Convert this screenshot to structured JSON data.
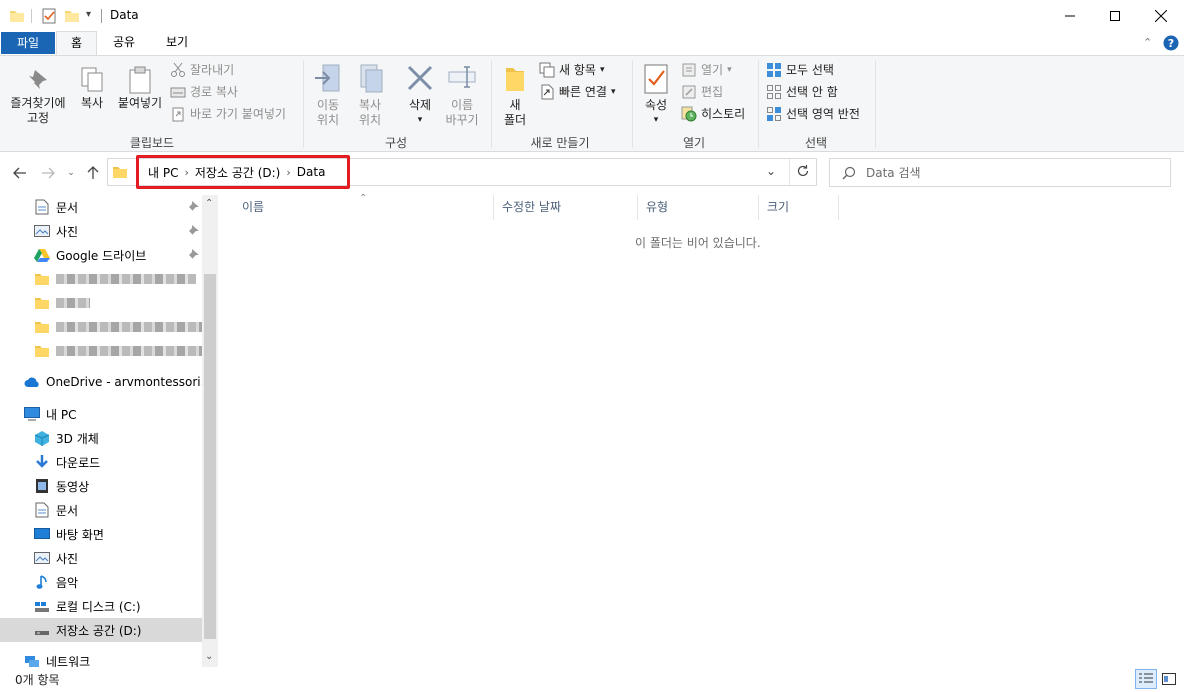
{
  "window": {
    "title": "Data",
    "controls": [
      "minimize-icon",
      "maximize-icon",
      "close-icon"
    ]
  },
  "ribbon_tabs": [
    {
      "label": "파일",
      "kind": "file"
    },
    {
      "label": "홈",
      "active": true
    },
    {
      "label": "공유"
    },
    {
      "label": "보기"
    }
  ],
  "ribbon": {
    "clipboard": {
      "group_label": "클립보드",
      "pin_line1": "즐겨찾기에",
      "pin_line2": "고정",
      "copy": "복사",
      "paste": "붙여넣기",
      "cut": "잘라내기",
      "copy_path": "경로 복사",
      "paste_shortcut": "바로 가기 붙여넣기"
    },
    "organize": {
      "group_label": "구성",
      "move_line1": "이동",
      "move_line2": "위치",
      "copyto_line1": "복사",
      "copyto_line2": "위치",
      "delete": "삭제",
      "rename_line1": "이름",
      "rename_line2": "바꾸기"
    },
    "new": {
      "group_label": "새로 만들기",
      "folder_line1": "새",
      "folder_line2": "폴더",
      "new_item": "새 항목",
      "easy_access": "빠른 연결"
    },
    "open": {
      "group_label": "열기",
      "properties": "속성",
      "open": "열기",
      "edit": "편집",
      "history": "히스토리"
    },
    "select": {
      "group_label": "선택",
      "select_all": "모두 선택",
      "select_none": "선택 안 함",
      "invert": "선택 영역 반전"
    }
  },
  "address": {
    "crumbs": [
      "내 PC",
      "저장소 공간 (D:)",
      "Data"
    ],
    "search_placeholder": "Data 검색",
    "highlight_color": "#e31b23"
  },
  "nav_pane": {
    "quick_access": [
      {
        "label": "문서",
        "icon": "document-icon",
        "pinned": true
      },
      {
        "label": "사진",
        "icon": "pictures-icon",
        "pinned": true
      },
      {
        "label": "Google 드라이브",
        "icon": "google-drive-icon",
        "pinned": true
      }
    ],
    "onedrive": "OneDrive - arvmontessori.org",
    "this_pc": "내 PC",
    "pc_items": [
      {
        "label": "3D 개체",
        "icon": "3d-objects-icon"
      },
      {
        "label": "다운로드",
        "icon": "downloads-icon"
      },
      {
        "label": "동영상",
        "icon": "videos-icon"
      },
      {
        "label": "문서",
        "icon": "document-icon"
      },
      {
        "label": "바탕 화면",
        "icon": "desktop-icon"
      },
      {
        "label": "사진",
        "icon": "pictures-icon"
      },
      {
        "label": "음악",
        "icon": "music-icon"
      },
      {
        "label": "로컬 디스크 (C:)",
        "icon": "local-disk-icon"
      },
      {
        "label": "저장소 공간 (D:)",
        "icon": "drive-icon",
        "selected": true
      }
    ],
    "network": "네트워크"
  },
  "columns": [
    "이름",
    "수정한 날짜",
    "유형",
    "크기"
  ],
  "empty_message": "이 폴더는 비어 있습니다.",
  "status": {
    "item_count": "0개 항목"
  },
  "colors": {
    "file_tab": "#1b66b4",
    "ribbon_bg": "#f5f6f7",
    "selected_nav": "#d9d9d9",
    "column_header": "#4c607a"
  }
}
